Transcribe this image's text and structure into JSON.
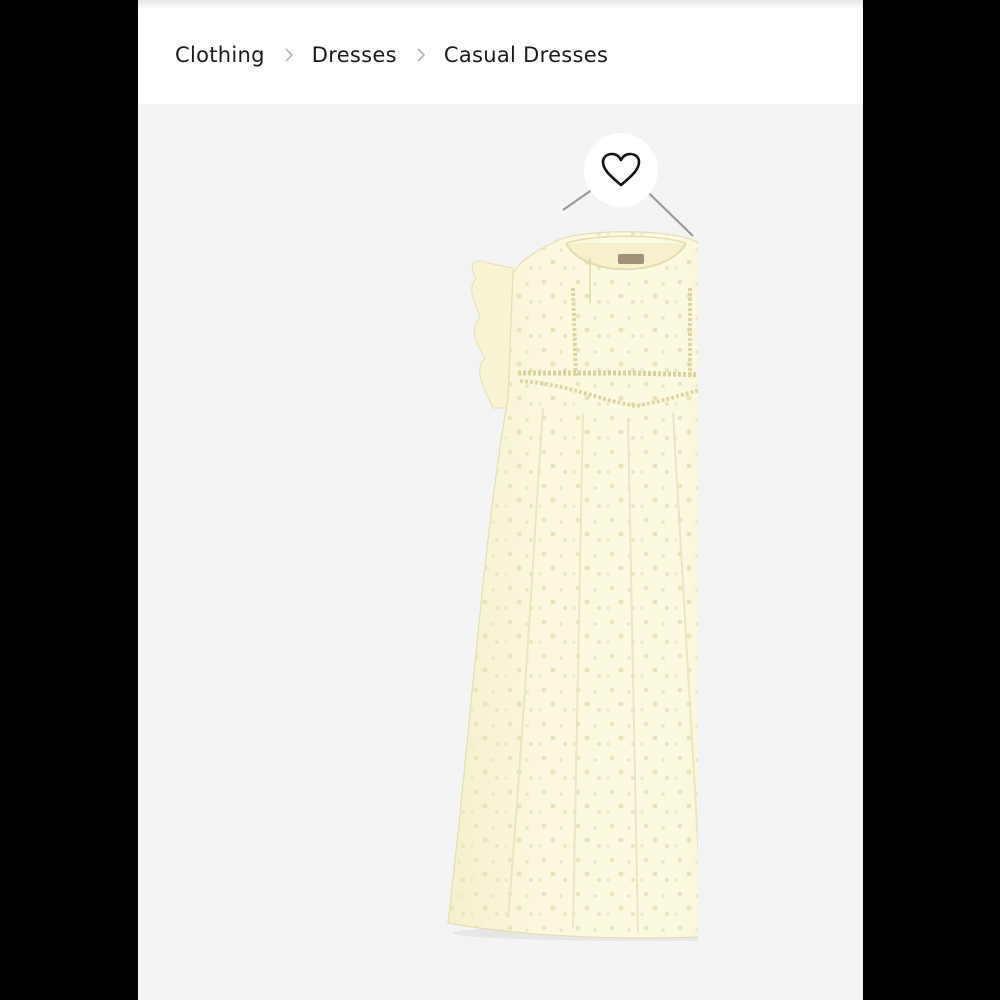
{
  "breadcrumb": {
    "items": [
      "Clothing",
      "Dresses",
      "Casual Dresses"
    ],
    "separator_icon": "chevron-right-icon"
  },
  "product": {
    "image_icon": "dress-on-hanger-illustration",
    "favorite_icon": "heart-outline-icon"
  },
  "colors": {
    "page_bg": "#000000",
    "header_bg": "#ffffff",
    "image_bg": "#f4f4f4",
    "dress": "#fbf7da",
    "text": "#1a1a1a"
  }
}
